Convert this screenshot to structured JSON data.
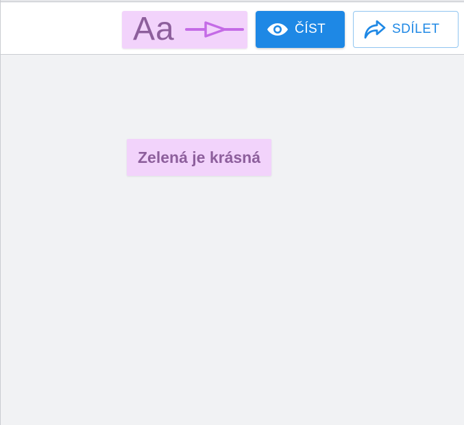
{
  "toolbar": {
    "font_tool": {
      "sample_text": "Aa",
      "icon": "arrow-right-icon"
    },
    "read_button": {
      "label": "ČÍST",
      "icon": "eye-icon"
    },
    "share_button": {
      "label": "SDÍLET",
      "icon": "share-icon"
    }
  },
  "content": {
    "text_item": "Zelená je krásná"
  },
  "colors": {
    "accent_blue": "#1e88e5",
    "highlight_pink": "#f2d3fb",
    "text_purple": "#8d5f9c",
    "arrow_violet": "#c46be6",
    "canvas_bg": "#f1f2f4"
  }
}
